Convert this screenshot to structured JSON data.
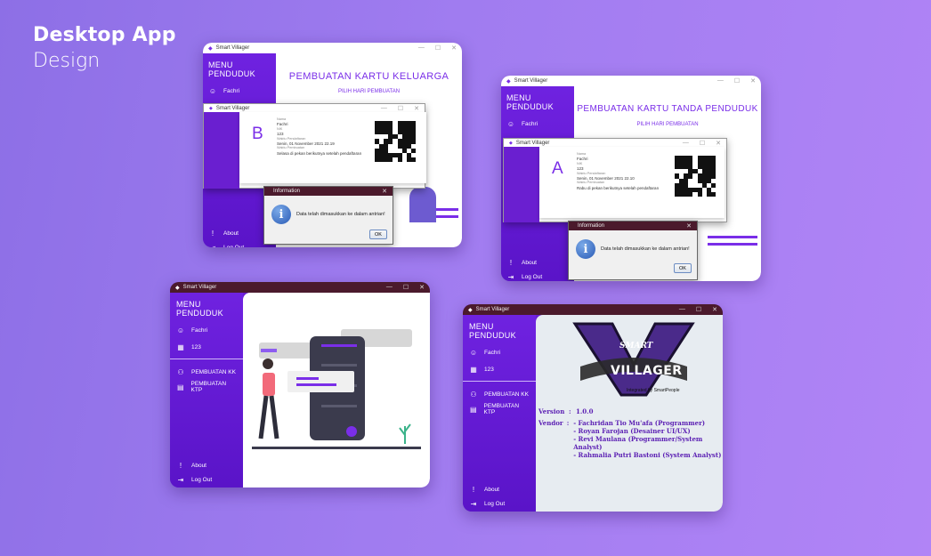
{
  "hero": {
    "line1": "Desktop App",
    "line2": "Design"
  },
  "app_title": "Smart Villager",
  "titlebar_controls": {
    "min": "—",
    "max": "☐",
    "close": "✕"
  },
  "sidebar": {
    "title": "MENU PENDUDUK",
    "user_name": "Fachri",
    "user_id": "123",
    "kk_label": "PEMBUATAN KK",
    "ktp_label": "PEMBUATAN KTP",
    "about": "About",
    "logout": "Log Out"
  },
  "kk_window": {
    "heading": "PEMBUATAN KARTU KELUARGA",
    "sub": "PILIH HARI PEMBUATAN",
    "ticket": {
      "letter": "B",
      "k_nama": "Nama",
      "nama": "Fachri",
      "k_nik": "NIK",
      "nik": "123",
      "k_daftar": "Waktu Pendaftaran",
      "daftar": "Senin, 01 November 2021 22.19",
      "k_buat": "Waktu Pembuatan",
      "buat": "Selasa di pekan berikutnya setelah pendaftaran"
    }
  },
  "ktp_window": {
    "heading": "PEMBUATAN KARTU TANDA PENDUDUK",
    "sub": "PILIH HARI PEMBUATAN",
    "ticket": {
      "letter": "A",
      "k_nama": "Nama",
      "nama": "Fachri",
      "k_nik": "NIK",
      "nik": "123",
      "k_daftar": "Waktu Pendaftaran",
      "daftar": "Senin, 01 November 2021 22.10",
      "k_buat": "Waktu Pembuatan",
      "buat": "Rabu di pekan berikutnya setelah pendaftaran"
    }
  },
  "info_dialog": {
    "title": "Information",
    "message": "Data telah dimasukkan ke dalam antrian!",
    "ok": "OK"
  },
  "about_window": {
    "logo_top": "SMART",
    "logo_main": "VILLAGER",
    "logo_tag": "Integrated by SmartPeople",
    "version_label": "Version",
    "version": "1.0.0",
    "vendor_label": "Vendor",
    "vendors": [
      "- Fachridan Tio Mu'afa (Programmer)",
      "- Royan Farojan (Desainer UI/UX)",
      "- Revi Maulana (Programmer/System Analyst)",
      "- Rahmalia Putri Bastoni (System Analyst)"
    ]
  },
  "colors": {
    "accent": "#7a2ee8",
    "sidebar": "#6a1fd0",
    "dialog_title": "#4b1a2c"
  }
}
